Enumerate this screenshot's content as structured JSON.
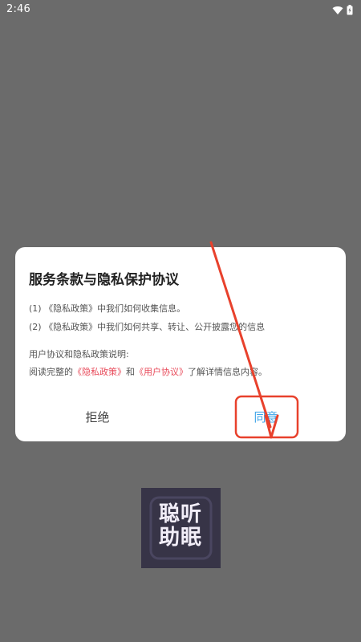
{
  "status_bar": {
    "time": "2:46",
    "icons": [
      "wifi-icon",
      "battery-icon"
    ]
  },
  "dialog": {
    "title": "服务条款与隐私保护协议",
    "line1": "(1) 《隐私政策》中我们如何收集信息。",
    "line2": "(2) 《隐私政策》中我们如何共享、转让、公开披露您的信息",
    "line3": "用户协议和隐私政策说明:",
    "line4_prefix": "阅读完整的",
    "line4_link1": "《隐私政策》",
    "line4_and": "和",
    "line4_link2": "《用户协议》",
    "line4_suffix": "了解详情信息内容。",
    "reject_label": "拒绝",
    "agree_label": "同意"
  },
  "app_logo": {
    "text_line1": "聪听",
    "text_line2": "助眠"
  },
  "colors": {
    "background": "#6b6b6b",
    "link": "#e84a5a",
    "agree": "#3ea4e8",
    "annotation": "#e8412c"
  }
}
